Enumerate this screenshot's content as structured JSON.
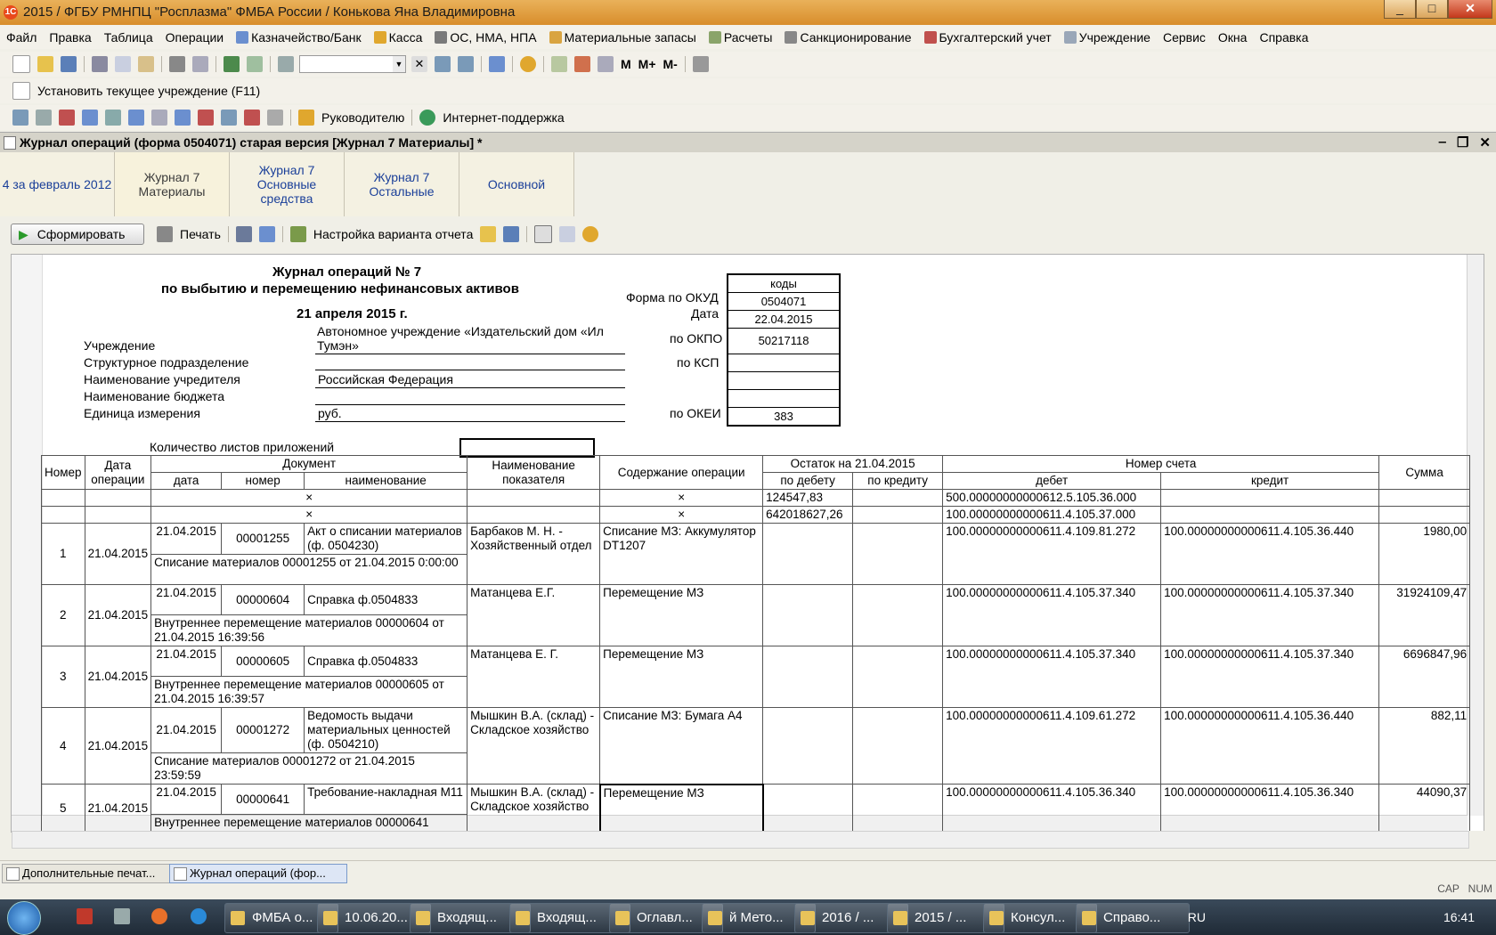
{
  "window": {
    "title": "2015 / ФГБУ РМНПЦ \"Росплазма\" ФМБА России / Конькова Яна Владимировна",
    "min": "_",
    "max": "□",
    "close": "✕"
  },
  "menu": [
    "Файл",
    "Правка",
    "Таблица",
    "Операции",
    "Казначейство/Банк",
    "Касса",
    "ОС, НМА, НПА",
    "Материальные запасы",
    "Расчеты",
    "Санкционирование",
    "Бухгалтерский учет",
    "Учреждение",
    "Сервис",
    "Окна",
    "Справка"
  ],
  "toolbar3": {
    "set_institution": "Установить текущее учреждение (F11)"
  },
  "toolbar4": {
    "manager": "Руководителю",
    "support": "Интернет-поддержка"
  },
  "child_window": {
    "title": "Журнал операций (форма 0504071) старая версия [Журнал 7 Материалы] *"
  },
  "tabs": [
    {
      "label": "4 за февраль 2012"
    },
    {
      "label": "Журнал 7 Материалы"
    },
    {
      "label": "Журнал 7 Основные средства"
    },
    {
      "label": "Журнал 7 Остальные"
    },
    {
      "label": "Основной"
    }
  ],
  "report_toolbar": {
    "generate": "Сформировать",
    "print": "Печать",
    "settings": "Настройка варианта отчета"
  },
  "report": {
    "title1": "Журнал операций № 7",
    "title2": "по выбытию и перемещению нефинансовых активов",
    "date": "21 апреля 2015 г.",
    "codes_header": "коды",
    "okud_label": "Форма по ОКУД",
    "okud": "0504071",
    "date_label": "Дата",
    "date_value": "22.04.2015",
    "okpo_label": "по ОКПО",
    "okpo": "50217118",
    "ksp_label": "по КСП",
    "okei_label": "по ОКЕИ",
    "okei": "383",
    "institution_label": "Учреждение",
    "institution_line1": "Автономное учреждение  «Издательский дом «Ил",
    "institution_line2": "Тумэн»",
    "subdivision_label": "Структурное подразделение",
    "founder_label": "Наименование учредителя",
    "founder": "Российская Федерация",
    "budget_label": "Наименование бюджета",
    "unit_label": "Единица измерения",
    "unit": "руб.",
    "sheets_label": "Количество листов приложений"
  },
  "table": {
    "h_num": "Номер",
    "h_opdate": "Дата операции",
    "h_doc": "Документ",
    "h_doc_date": "дата",
    "h_doc_num": "номер",
    "h_doc_name": "наименование",
    "h_indicator": "Наименование показателя",
    "h_content": "Содержание операции",
    "h_balance": "Остаток на 21.04.2015",
    "h_debit_bal": "по дебету",
    "h_credit_bal": "по кредиту",
    "h_account": "Номер счета",
    "h_debit": "дебет",
    "h_credit": "кредит",
    "h_sum": "Сумма",
    "x": "×",
    "bal1_debit": "124547,83",
    "bal1_account": "500.00000000000612.5.105.36.000",
    "bal2_debit": "642018627,26",
    "bal2_account": "100.00000000000611.4.105.37.000",
    "rows": [
      {
        "n": "1",
        "opdate": "21.04.2015",
        "docdate": "21.04.2015",
        "docnum": "00001255",
        "docname": "Акт о списании материалов (ф. 0504230)",
        "desc": "Списание материалов 00001255 от 21.04.2015 0:00:00",
        "indicator": "Барбаков М. Н. - Хозяйственный отдел",
        "content": "Списание МЗ: Аккумулятор DT1207",
        "debit": "100.00000000000611.4.109.81.272",
        "credit": "100.00000000000611.4.105.36.440",
        "sum": "1980,00"
      },
      {
        "n": "2",
        "opdate": "21.04.2015",
        "docdate": "21.04.2015",
        "docnum": "00000604",
        "docname": "Справка ф.0504833",
        "desc": "Внутреннее перемещение материалов 00000604 от 21.04.2015 16:39:56",
        "indicator": "Матанцева Е.Г.",
        "content": "Перемещение МЗ",
        "debit": "100.00000000000611.4.105.37.340",
        "credit": "100.00000000000611.4.105.37.340",
        "sum": "31924109,47"
      },
      {
        "n": "3",
        "opdate": "21.04.2015",
        "docdate": "21.04.2015",
        "docnum": "00000605",
        "docname": "Справка ф.0504833",
        "desc": "Внутреннее перемещение материалов 00000605 от 21.04.2015 16:39:57",
        "indicator": "Матанцева Е. Г.",
        "content": "Перемещение МЗ",
        "debit": "100.00000000000611.4.105.37.340",
        "credit": "100.00000000000611.4.105.37.340",
        "sum": "6696847,96"
      },
      {
        "n": "4",
        "opdate": "21.04.2015",
        "docdate": "21.04.2015",
        "docnum": "00001272",
        "docname": "Ведомость выдачи материальных ценностей (ф. 0504210)",
        "desc": "Списание материалов 00001272 от 21.04.2015 23:59:59",
        "indicator": "Мышкин В.А. (склад) - Складское хозяйство",
        "content": "Списание МЗ: Бумага А4",
        "debit": "100.00000000000611.4.109.61.272",
        "credit": "100.00000000000611.4.105.36.440",
        "sum": "882,11"
      },
      {
        "n": "5",
        "opdate": "21.04.2015",
        "docdate": "21.04.2015",
        "docnum": "00000641",
        "docname": "Требование-накладная М11",
        "desc": "Внутреннее перемещение материалов 00000641",
        "indicator": "Мышкин В.А. (склад) - Складское хозяйство",
        "content": "Перемещение МЗ",
        "debit": "100.00000000000611.4.105.36.340",
        "credit": "100.00000000000611.4.105.36.340",
        "sum": "44090,37"
      }
    ]
  },
  "status": {
    "tab1": "Дополнительные печат...",
    "tab2": "Журнал операций (фор...",
    "cap": "CAP",
    "num": "NUM"
  },
  "taskbar": {
    "items": [
      "ФМБА о...",
      "10.06.20...",
      "Входящ...",
      "Входящ...",
      "Оглавл...",
      "й Мето...",
      "2016 / ...",
      "2015 / ...",
      "Консул...",
      "Справо..."
    ],
    "lang": "RU",
    "time": "16:41"
  }
}
